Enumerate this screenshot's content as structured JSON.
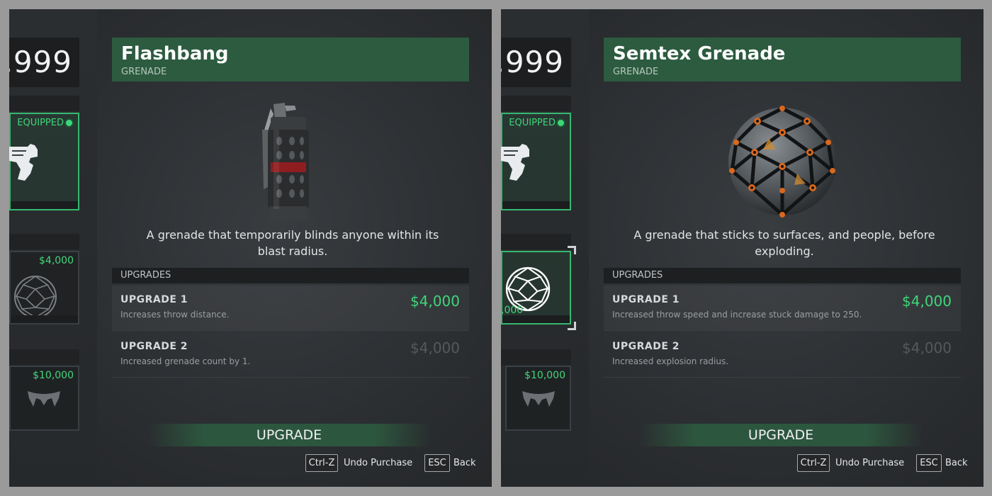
{
  "panels": [
    {
      "money": ",999",
      "equipped_label": "EQUIPPED",
      "side_prices": [
        "$4,000",
        "$10,000"
      ],
      "item": {
        "name": "Flashbang",
        "category": "GRENADE",
        "description": "A grenade that temporarily blinds anyone within its blast radius."
      },
      "upgrades_header": "UPGRADES",
      "upgrades": [
        {
          "title": "UPGRADE 1",
          "description": "Increases throw distance.",
          "price": "$4,000"
        },
        {
          "title": "UPGRADE 2",
          "description": "Increased grenade count by 1.",
          "price": "$4,000"
        }
      ],
      "upgrade_button": "UPGRADE",
      "hints": [
        {
          "key": "Ctrl-Z",
          "label": "Undo Purchase"
        },
        {
          "key": "ESC",
          "label": "Back"
        }
      ]
    },
    {
      "money": ",999",
      "equipped_label": "EQUIPPED",
      "side_prices": [
        ",000",
        "$10,000"
      ],
      "item": {
        "name": "Semtex Grenade",
        "category": "GRENADE",
        "description": "A grenade that sticks to surfaces, and people, before exploding."
      },
      "upgrades_header": "UPGRADES",
      "upgrades": [
        {
          "title": "UPGRADE 1",
          "description": "Increased throw speed and increase stuck damage to 250.",
          "price": "$4,000"
        },
        {
          "title": "UPGRADE 2",
          "description": "Increased explosion radius.",
          "price": "$4,000"
        }
      ],
      "upgrade_button": "UPGRADE",
      "hints": [
        {
          "key": "Ctrl-Z",
          "label": "Undo Purchase"
        },
        {
          "key": "ESC",
          "label": "Back"
        }
      ]
    }
  ],
  "colors": {
    "accent_green": "#3fd67b",
    "title_bar": "#2c5b3f",
    "disabled_price": "#55595c"
  },
  "icons": [
    "pistol-icon",
    "geodesic-sphere-icon",
    "fangs-icon",
    "flashbang-grenade-icon",
    "semtex-grenade-icon",
    "status-dot-icon"
  ]
}
